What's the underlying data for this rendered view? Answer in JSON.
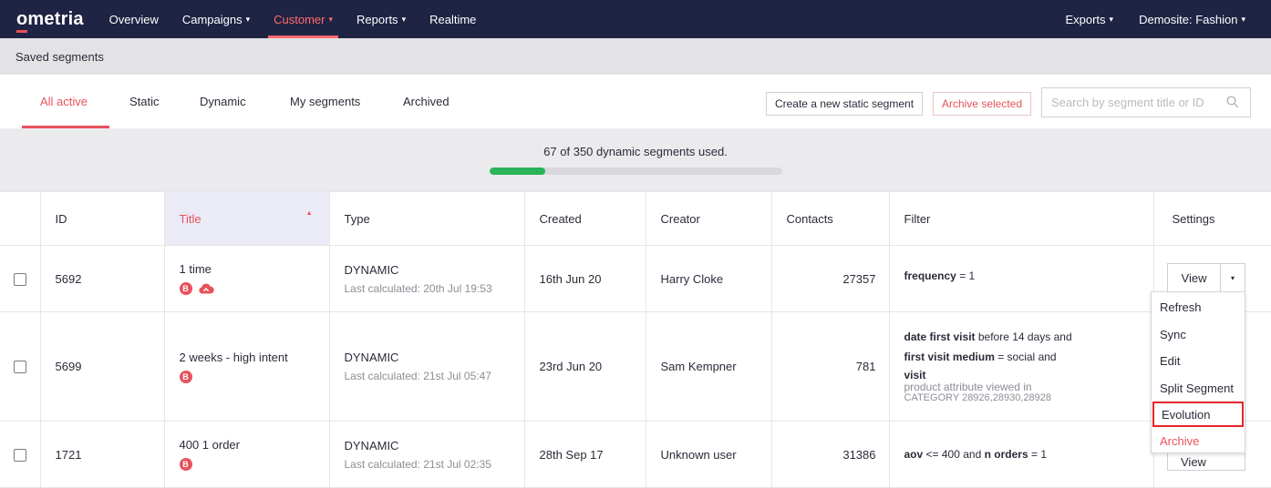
{
  "nav": {
    "logo": "ometria",
    "items": [
      {
        "label": "Overview",
        "caret": ""
      },
      {
        "label": "Campaigns",
        "caret": "▾"
      },
      {
        "label": "Customer",
        "caret": "▾"
      },
      {
        "label": "Reports",
        "caret": "▾"
      },
      {
        "label": "Realtime",
        "caret": ""
      }
    ],
    "right_items": [
      {
        "label": "Exports",
        "caret": "▾"
      },
      {
        "label": "Demosite: Fashion",
        "caret": "▾"
      }
    ],
    "active_color": "#ff6b6b",
    "bg_color": "#1f2344"
  },
  "subheader": {
    "title": "Saved segments"
  },
  "tabs": [
    "All active",
    "Static",
    "Dynamic",
    "My segments",
    "Archived"
  ],
  "actions": {
    "create_label": "Create a new static segment",
    "archive_label": "Archive selected",
    "search_placeholder": "Search by segment title or ID"
  },
  "usage": {
    "text": "67 of 350 dynamic segments used.",
    "used": 67,
    "total": 350,
    "bar_color": "#2bb35a"
  },
  "table": {
    "columns": [
      "ID",
      "Title",
      "Type",
      "Created",
      "Creator",
      "Contacts",
      "Filter",
      "Settings"
    ],
    "sort_caret": "▲",
    "rows": [
      {
        "id": "5692",
        "title": "1 time",
        "badge": "B",
        "type": "DYNAMIC",
        "last_calculated": "Last calculated: 20th Jul 19:53",
        "created": "16th Jun 20",
        "creator": "Harry Cloke",
        "contacts": "27357",
        "filter": {
          "field": "frequency",
          "op": "= 1"
        }
      },
      {
        "id": "5699",
        "title": "2 weeks - high intent",
        "badge": "B",
        "type": "DYNAMIC",
        "last_calculated": "Last calculated: 21st Jul 05:47",
        "created": "23rd Jun 20",
        "creator": "Sam Kempner",
        "contacts": "781",
        "filter": {
          "f1": "date first visit",
          "f1_rest": "before 14 days",
          "and1": "and",
          "f2": "first visit medium",
          "f2_rest": "= social",
          "and2": "and",
          "f3": "visit",
          "f3_sub": "product attribute viewed",
          "f3_in": "in",
          "f3_cat": "CATEGORY 28926,28930,28928"
        }
      },
      {
        "id": "1721",
        "title": "400 1 order",
        "badge": "B",
        "type": "DYNAMIC",
        "last_calculated": "Last calculated: 21st Jul 02:35",
        "created": "28th Sep 17",
        "creator": "Unknown user",
        "contacts": "31386",
        "filter": {
          "f1": "aov",
          "f1_rest": "<= 400",
          "and": "and",
          "f2": "n orders",
          "f2_rest": "= 1"
        }
      }
    ]
  },
  "settings": {
    "view_label": "View",
    "caret": "▾",
    "menu": [
      "Refresh",
      "Sync",
      "Edit",
      "Split Segment",
      "Evolution",
      "Archive"
    ],
    "highlight_color": "#e8252b"
  }
}
